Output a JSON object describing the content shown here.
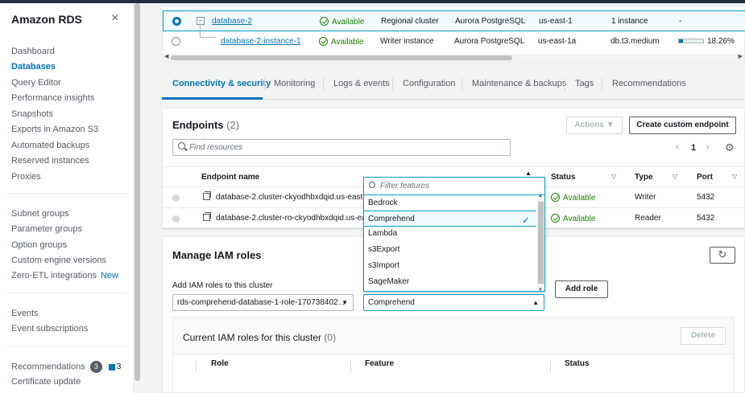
{
  "sidebar": {
    "title": "Amazon RDS",
    "close_icon": "×",
    "items_group1": [
      "Dashboard",
      "Databases",
      "Query Editor",
      "Performance insights",
      "Snapshots",
      "Exports in Amazon S3",
      "Automated backups",
      "Reserved instances",
      "Proxies"
    ],
    "items_group2": [
      "Subnet groups",
      "Parameter groups",
      "Option groups",
      "Custom engine versions",
      "Zero-ETL integrations"
    ],
    "new_label": "New",
    "items_group3": [
      "Events",
      "Event subscriptions"
    ],
    "recommendations": {
      "label": "Recommendations",
      "count": "3",
      "count2": "3"
    },
    "certificate_update": "Certificate update"
  },
  "db_table": {
    "rows": [
      {
        "name": "database-2",
        "status": "Available",
        "role": "Regional cluster",
        "engine": "Aurora PostgreSQL",
        "region": "us-east-1",
        "size": "1 instance",
        "cpu": "-"
      },
      {
        "name": "database-2-instance-1",
        "status": "Available",
        "role": "Writer instance",
        "engine": "Aurora PostgreSQL",
        "region": "us-east-1a",
        "size": "db.t3.medium",
        "cpu": "18.26%",
        "cpu_fraction": 0.18
      }
    ],
    "expand_glyph": "−"
  },
  "tabs": [
    "Connectivity & security",
    "Monitoring",
    "Logs & events",
    "Configuration",
    "Maintenance & backups",
    "Tags",
    "Recommendations"
  ],
  "endpoints": {
    "title": "Endpoints",
    "count": "(2)",
    "actions_label": "Actions",
    "create_label": "Create custom endpoint",
    "search_placeholder": "Find resources",
    "page": "1",
    "columns": [
      "Endpoint name",
      "Status",
      "Type",
      "Port"
    ],
    "rows": [
      {
        "name": "database-2.cluster-ckyodhbxdqid.us-east-1.r",
        "status": "Available",
        "type": "Writer",
        "port": "5432"
      },
      {
        "name": "database-2.cluster-ro-ckyodhbxdqid.us-east-",
        "status": "Available",
        "type": "Reader",
        "port": "5432"
      }
    ]
  },
  "feature_dropdown": {
    "filter_placeholder": "Filter features",
    "options": [
      "Bedrock",
      "Comprehend",
      "Lambda",
      "s3Export",
      "s3Import",
      "SageMaker"
    ],
    "selected": "Comprehend"
  },
  "iam": {
    "title": "Manage IAM roles",
    "add_label": "Add IAM roles to this cluster",
    "role_value": "rds-comprehend-database-1-role-170738402...",
    "feature_value": "Comprehend",
    "add_button": "Add role",
    "current_title": "Current IAM roles for this cluster",
    "current_count": "(0)",
    "delete_button": "Delete",
    "columns": [
      "Role",
      "Feature",
      "Status"
    ]
  },
  "colors": {
    "accent": "#0073bb",
    "success": "#1d8102",
    "focus": "#00a1c9"
  }
}
